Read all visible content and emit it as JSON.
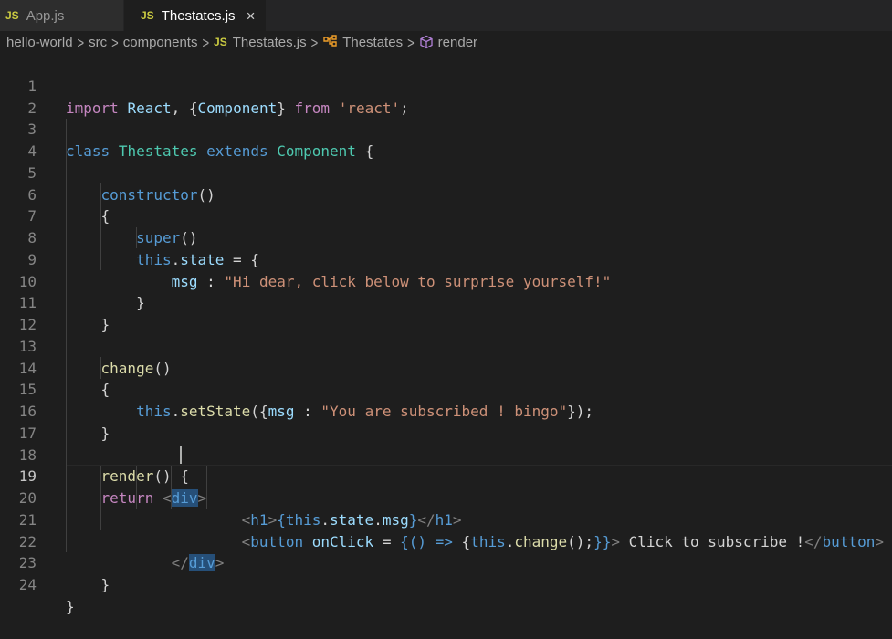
{
  "tabs": [
    {
      "icon": "JS",
      "label": "App.js"
    },
    {
      "icon": "JS",
      "label": "Thestates.js",
      "close": "×"
    }
  ],
  "breadcrumb": {
    "items": [
      "hello-world",
      "src",
      "components"
    ],
    "file_icon": "JS",
    "file": "Thestates.js",
    "class": "Thestates",
    "method": "render"
  },
  "editor": {
    "active_line": 19,
    "line_numbers": [
      "1",
      "2",
      "3",
      "4",
      "5",
      "6",
      "7",
      "8",
      "9",
      "10",
      "11",
      "12",
      "13",
      "14",
      "15",
      "16",
      "17",
      "18",
      "19",
      "20",
      "21",
      "22",
      "23",
      "24"
    ],
    "tokens": {
      "import": "import",
      "react_id": "React",
      "comma": ",",
      "brace_open": "{",
      "component": "Component",
      "brace_close": "}",
      "from": "from",
      "react_str": "'react'",
      "semicolon": ";",
      "class": "class",
      "classname": "Thestates",
      "extends": "extends",
      "constructor": "constructor",
      "parens": "()",
      "super": "super",
      "this": "this",
      "dot": ".",
      "state": "state",
      "eq": "=",
      "msg": "msg",
      "colon": ":",
      "msg1": "\"Hi dear, click below to surprise yourself!\"",
      "change": "change",
      "setState": "setState",
      "paren_open": "(",
      "msg2": "\"You are subscribed ! bingo\"",
      "close_call": "});",
      "render": "render",
      "return": "return",
      "lt": "<",
      "gt": ">",
      "div_d": "d",
      "div_iv": "iv",
      "h1": "h1",
      "state_msg_open": "{",
      "state_msg_close": "}",
      "lt_slash": "</",
      "button": "button",
      "onClick": "onClick",
      "arrow_open": "{(",
      "paren_close": ")",
      "arrow": "=>",
      "change_call": "change",
      "call_end": "();",
      "arrow_close": "}}",
      "button_text": "Click to subscribe !",
      "div": "div"
    }
  }
}
